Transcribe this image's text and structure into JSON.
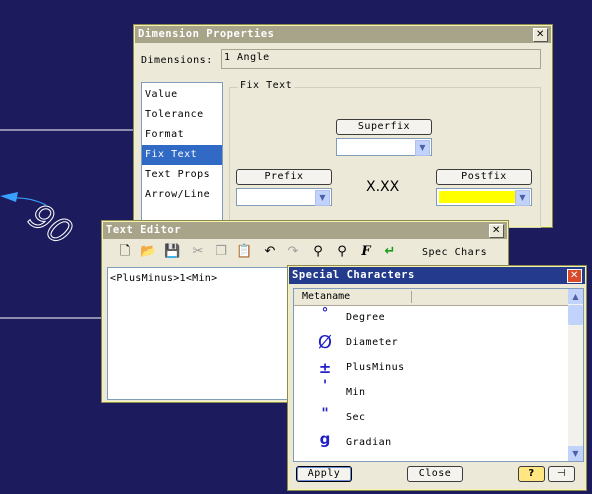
{
  "background": {
    "color": "#1c1b5e",
    "dimension_text": "90"
  },
  "dimension_props": {
    "title": "Dimension Properties",
    "dimensions_label": "Dimensions:",
    "dimensions_value": "1 Angle",
    "list": [
      "Value",
      "Tolerance",
      "Format",
      "Fix Text",
      "Text Props",
      "Arrow/Line"
    ],
    "selected": "Fix Text",
    "group_label": "Fix Text",
    "superfix_label": "Superfix",
    "prefix_label": "Prefix",
    "postfix_label": "Postfix",
    "preview_text": "X.XX",
    "postfix_color": "#ffff00"
  },
  "text_editor": {
    "title": "Text Editor",
    "content": "<PlusMinus>1<Min>",
    "spec_chars_label": "Spec Chars",
    "toolbar_icons": [
      "new-icon",
      "open-icon",
      "save-icon",
      "cut-icon",
      "copy-icon",
      "paste-icon",
      "undo-icon",
      "redo-icon",
      "find-icon",
      "replace-icon",
      "font-icon",
      "enter-icon"
    ]
  },
  "special_chars": {
    "title": "Special Characters",
    "column_header": "Metaname",
    "items": [
      {
        "symbol": "°",
        "name": "Degree"
      },
      {
        "symbol": "Ø",
        "name": "Diameter"
      },
      {
        "symbol": "±",
        "name": "PlusMinus"
      },
      {
        "symbol": "'",
        "name": "Min"
      },
      {
        "symbol": "\"",
        "name": "Sec"
      },
      {
        "symbol": "g",
        "name": "Gradian"
      }
    ],
    "apply_label": "Apply",
    "close_label": "Close",
    "help_icon": "?",
    "pin_icon": "pin-icon"
  }
}
